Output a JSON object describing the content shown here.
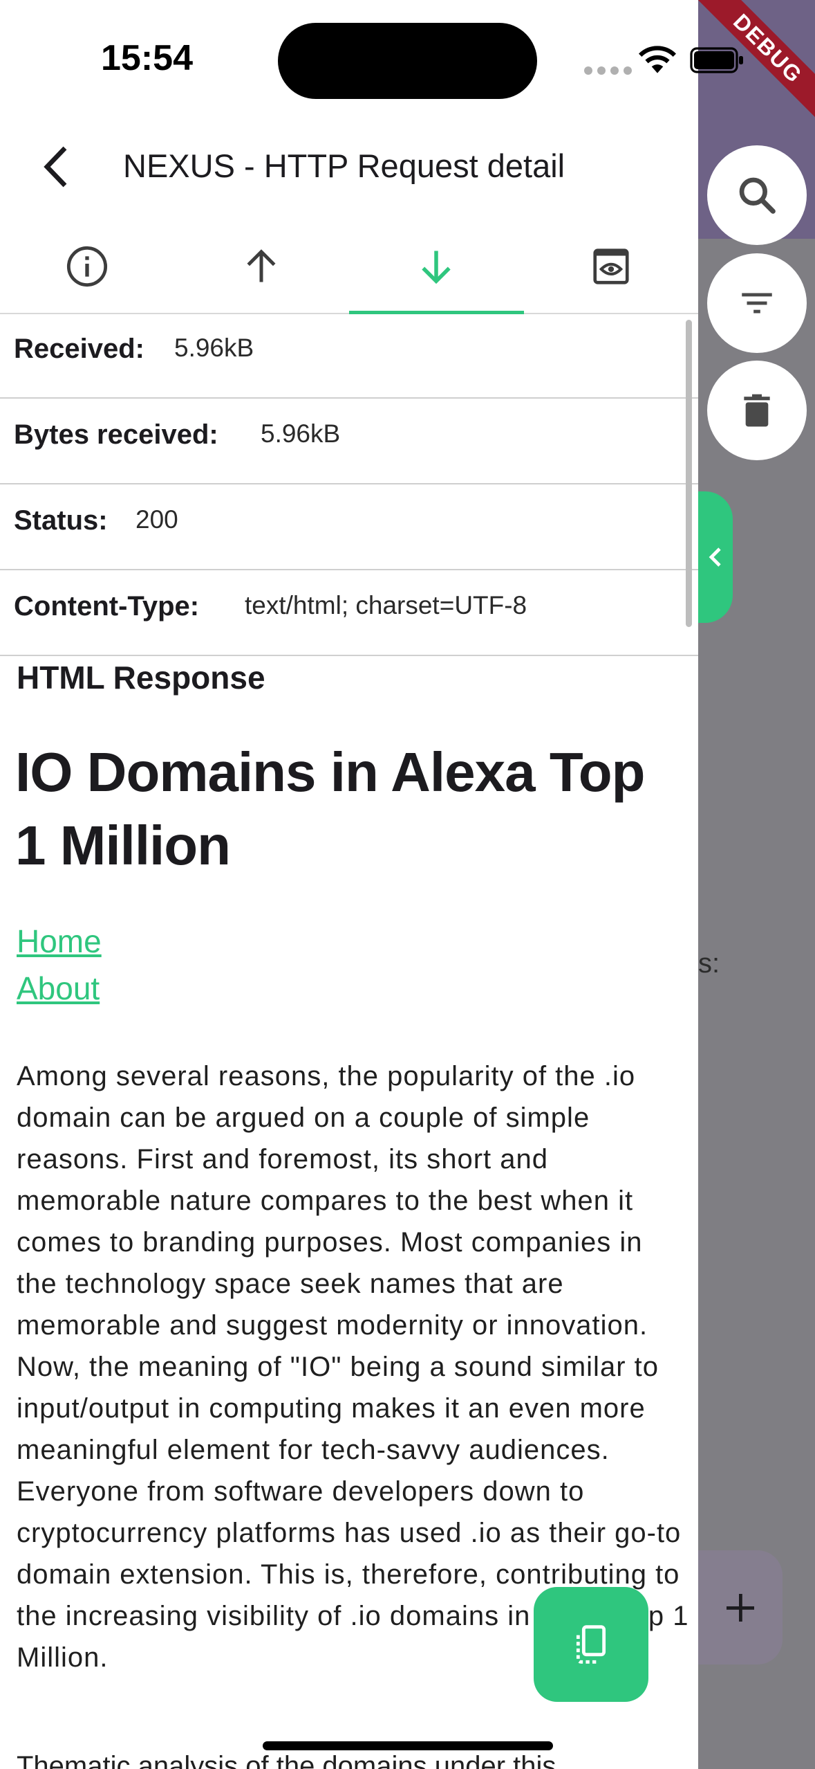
{
  "status_bar": {
    "time": "15:54"
  },
  "debug_banner": "DEBUG",
  "app_bar": {
    "title": "NEXUS - HTTP Request detail"
  },
  "tabs": [
    {
      "icon": "info-icon",
      "selected": false
    },
    {
      "icon": "arrow-up-icon",
      "selected": false
    },
    {
      "icon": "arrow-down-icon",
      "selected": true
    },
    {
      "icon": "preview-icon",
      "selected": false
    }
  ],
  "response": {
    "received_label": "Received:",
    "received_value": "5.96kB",
    "bytes_label": "Bytes received:",
    "bytes_value": "5.96kB",
    "status_label": "Status:",
    "status_value": "200",
    "content_type_label": "Content-Type:",
    "content_type_value": "text/html; charset=UTF-8"
  },
  "html_response": {
    "section_title": "HTML Response",
    "heading": "IO Domains in Alexa Top 1 Million",
    "links": [
      "Home",
      "About"
    ],
    "paragraph": "Among several reasons, the popularity of the .io domain can be argued on a couple of simple reasons. First and foremost, its short and memorable nature compares to the best when it comes to branding purposes. Most companies in the technology space seek names that are memorable and suggest modernity or innovation. Now, the meaning of \"IO\" being a sound similar to input/output in computing makes it an even more meaningful element for tech-savvy audiences. Everyone from software developers down to cryptocurrency platforms has used .io as their go-to domain extension. This is, therefore, contributing to the increasing visibility of .io domains in Alexa Top 1 Million.",
    "next_paragraph_start": "Thematic analysis of the domains under this"
  },
  "background_partial_text": "s:",
  "colors": {
    "accent": "#2fc67e",
    "background_overlay": "#7f7e83",
    "app_bar_behind": "#6e6286",
    "debug": "#9c1a2a"
  }
}
